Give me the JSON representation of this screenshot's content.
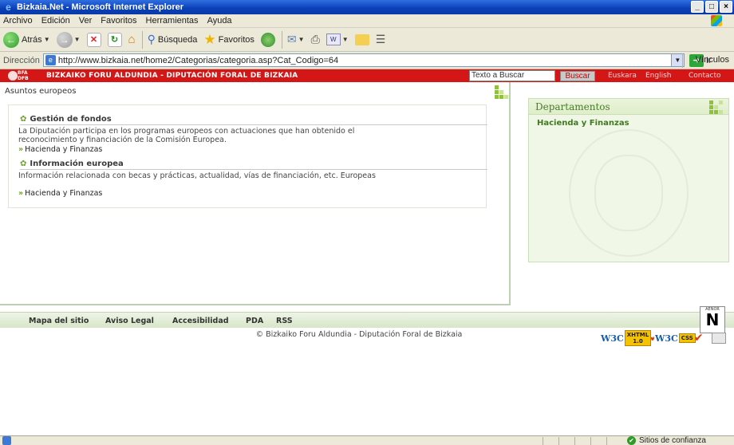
{
  "window": {
    "title": "Bizkaia.Net - Microsoft Internet Explorer",
    "controls": [
      "_",
      "□",
      "×"
    ]
  },
  "menu": [
    "Archivo",
    "Edición",
    "Ver",
    "Favoritos",
    "Herramientas",
    "Ayuda"
  ],
  "toolbar": {
    "back_label": "Atrás",
    "search_label": "Búsqueda",
    "favorites_label": "Favoritos"
  },
  "address": {
    "label": "Dirección",
    "url": "http://www.bizkaia.net/home2/Categorias/categoria.asp?Cat_Codigo=64",
    "go_label": "Ir",
    "links_label": "Vínculos"
  },
  "header": {
    "logo_line1": "BFA",
    "logo_line2": "DFB",
    "org_name": "BIZKAIKO FORU ALDUNDIA - DIPUTACIÓN FORAL DE BIZKAIA",
    "search_value": "Texto a Buscar",
    "search_button": "Buscar",
    "languages": [
      "Euskara",
      "English",
      "Contacto"
    ]
  },
  "main": {
    "breadcrumb": "Asuntos europeos",
    "sections": [
      {
        "title": "Gestión de fondos",
        "description": "La Diputación participa en los programas europeos con actuaciones que han obtenido el reconocimiento y financiación de la Comisión Europea.",
        "link": "Hacienda y Finanzas"
      },
      {
        "title": "Información europea",
        "description": "Información relacionada con becas y prácticas, actualidad, vías de financiación, etc. Europeas",
        "link": "Hacienda y Finanzas"
      }
    ]
  },
  "sidebar": {
    "title": "Departamentos",
    "link": "Hacienda y Finanzas"
  },
  "footer": {
    "links": [
      "Mapa del sitio",
      "Aviso Legal",
      "Accesibilidad",
      "PDA",
      "RSS"
    ],
    "copyright": "© Bizkaiko Foru Aldundia - Diputación Foral de Bizkaia",
    "badges": {
      "w3c": "W3C",
      "xhtml_line1": "XHTML",
      "xhtml_line2": "1.0",
      "css": "CSS",
      "aenor": "AENOR",
      "aenor_letter": "N"
    }
  },
  "status": {
    "zone": "Sitios de confianza"
  },
  "colors": {
    "header_red": "#d41616",
    "accent_green": "#8fc23a",
    "sidebar_bg": "#f1f7e6"
  }
}
